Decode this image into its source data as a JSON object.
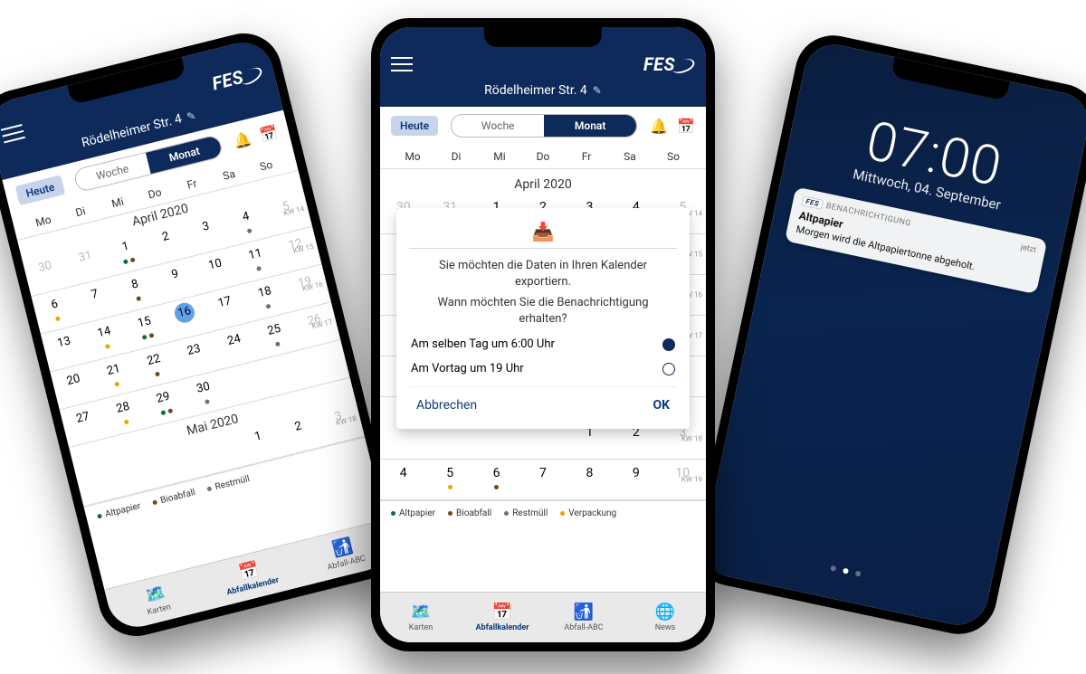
{
  "brand": "FES",
  "address": "Rödelheimer Str. 4",
  "heute": "Heute",
  "segment": {
    "woche": "Woche",
    "monat": "Monat",
    "active": "Monat"
  },
  "weekdays": [
    "Mo",
    "Di",
    "Mi",
    "Do",
    "Fr",
    "Sa",
    "So"
  ],
  "months": {
    "april": "April 2020",
    "mai": "Mai 2020"
  },
  "kw": {
    "14": "KW 14",
    "15": "KW 15",
    "16": "KW 16",
    "17": "KW 17",
    "18": "KW 18",
    "19": "KW 19"
  },
  "legend": {
    "altpapier": "Altpapier",
    "bioabfall": "Bioabfall",
    "restmuell": "Restmüll",
    "verpackung": "Verpackung"
  },
  "tabs": {
    "karten": "Karten",
    "abfallkalender": "Abfallkalender",
    "abfallabc": "Abfall-ABC",
    "news": "News"
  },
  "april_rows": [
    {
      "kw": "KW 14",
      "cells": [
        {
          "n": "30",
          "dim": true
        },
        {
          "n": "31",
          "dim": true
        },
        {
          "n": "1",
          "dots": [
            "g",
            "b"
          ]
        },
        {
          "n": "2"
        },
        {
          "n": "3"
        },
        {
          "n": "4",
          "dots": [
            "r"
          ]
        },
        {
          "n": "5",
          "dim": true
        }
      ]
    },
    {
      "kw": "KW 15",
      "cells": [
        {
          "n": "6",
          "dots": [
            "o"
          ]
        },
        {
          "n": "7"
        },
        {
          "n": "8",
          "dots": [
            "b"
          ]
        },
        {
          "n": "9"
        },
        {
          "n": "10"
        },
        {
          "n": "11",
          "dots": [
            "r"
          ]
        },
        {
          "n": "12",
          "dim": true
        }
      ]
    },
    {
      "kw": "KW 16",
      "cells": [
        {
          "n": "13"
        },
        {
          "n": "14",
          "dots": [
            "o"
          ]
        },
        {
          "n": "15",
          "dots": [
            "g",
            "b"
          ]
        },
        {
          "n": "16",
          "today": true
        },
        {
          "n": "17"
        },
        {
          "n": "18",
          "dots": [
            "r"
          ]
        },
        {
          "n": "19",
          "dim": true
        }
      ]
    },
    {
      "kw": "KW 17",
      "cells": [
        {
          "n": "20"
        },
        {
          "n": "21",
          "dots": [
            "o"
          ]
        },
        {
          "n": "22",
          "dots": [
            "b"
          ]
        },
        {
          "n": "23"
        },
        {
          "n": "24"
        },
        {
          "n": "25",
          "dots": [
            "r"
          ]
        },
        {
          "n": "26",
          "dim": true
        }
      ]
    },
    {
      "kw": "",
      "cells": [
        {
          "n": "27"
        },
        {
          "n": "28",
          "dots": [
            "o"
          ]
        },
        {
          "n": "29",
          "dots": [
            "g",
            "b"
          ]
        },
        {
          "n": "30",
          "dots": [
            "r"
          ]
        },
        {
          "n": ""
        },
        {
          "n": ""
        },
        {
          "n": ""
        }
      ]
    }
  ],
  "mai_rows": [
    {
      "kw": "KW 18",
      "cells": [
        {
          "n": ""
        },
        {
          "n": ""
        },
        {
          "n": ""
        },
        {
          "n": ""
        },
        {
          "n": "1"
        },
        {
          "n": "2"
        },
        {
          "n": "3",
          "dim": true
        }
      ]
    },
    {
      "kw": "KW 19",
      "cells": [
        {
          "n": "4"
        },
        {
          "n": "5",
          "dots": [
            "o"
          ]
        },
        {
          "n": "6",
          "dots": [
            "b"
          ]
        },
        {
          "n": "7"
        },
        {
          "n": "8"
        },
        {
          "n": "9"
        },
        {
          "n": "10",
          "dim": true
        }
      ]
    }
  ],
  "dialog": {
    "line1": "Sie möchten die Daten in Ihren Kalender exportiern.",
    "line2": "Wann möchten Sie die Benachrichtigung erhalten?",
    "opt1": "Am selben Tag um 6:00 Uhr",
    "opt2": "Am Vortag um 19 Uhr",
    "cancel": "Abbrechen",
    "ok": "OK"
  },
  "lock": {
    "time": "07:00",
    "date": "Mittwoch, 04. September",
    "app": "BENACHRICHTIGUNG",
    "when": "jetzt",
    "title": "Altpapier",
    "body": "Morgen wird die Altpapiertonne abgeholt."
  }
}
